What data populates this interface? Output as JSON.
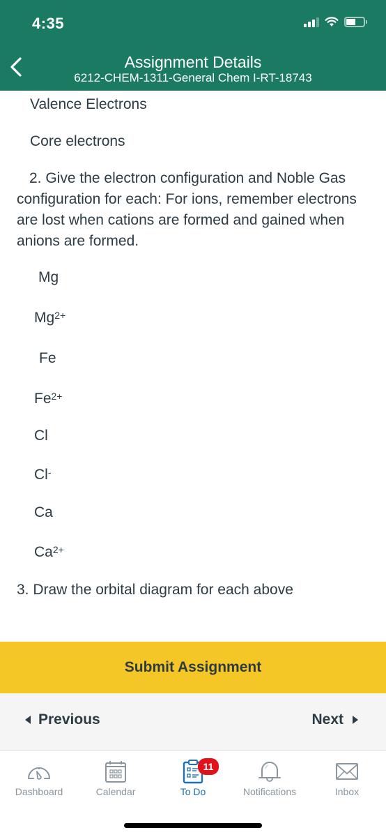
{
  "status_bar": {
    "time": "4:35"
  },
  "header": {
    "title": "Assignment Details",
    "subtitle": "6212-CHEM-1311-General Chem I-RT-18743"
  },
  "content": {
    "valence": "Valence Electrons",
    "core": "Core electrons",
    "question2": "2. Give the electron configuration and Noble Gas configuration for each: For ions, remember electrons are lost when cations are formed and gained when anions are formed.",
    "elements": [
      {
        "symbol": "Mg",
        "charge": ""
      },
      {
        "symbol": "Mg",
        "charge": "2+"
      },
      {
        "symbol": "Fe",
        "charge": ""
      },
      {
        "symbol": "Fe",
        "charge": "2+"
      },
      {
        "symbol": "Cl",
        "charge": ""
      },
      {
        "symbol": "Cl",
        "charge": "-"
      },
      {
        "symbol": "Ca",
        "charge": ""
      },
      {
        "symbol": "Ca",
        "charge": "2+"
      }
    ],
    "question3": "3. Draw the orbital diagram for each above"
  },
  "actions": {
    "submit_label": "Submit Assignment",
    "previous_label": "Previous",
    "next_label": "Next"
  },
  "tabbar": {
    "items": [
      {
        "label": "Dashboard",
        "icon": "dashboard-gauge-icon",
        "active": false
      },
      {
        "label": "Calendar",
        "icon": "calendar-icon",
        "active": false
      },
      {
        "label": "To Do",
        "icon": "todo-clipboard-icon",
        "active": true,
        "badge": "11"
      },
      {
        "label": "Notifications",
        "icon": "bell-icon",
        "active": false
      },
      {
        "label": "Inbox",
        "icon": "envelope-icon",
        "active": false
      }
    ]
  },
  "colors": {
    "header_green": "#1a7a62",
    "submit_yellow": "#f4c626",
    "active_blue": "#1d6fb8",
    "badge_red": "#e0131b",
    "text_dark": "#2d3b45",
    "inactive_gray": "#8b969e"
  }
}
